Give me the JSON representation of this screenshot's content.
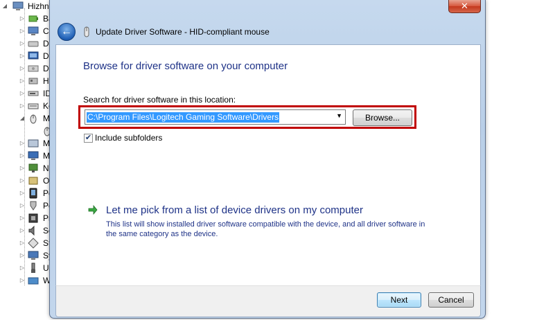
{
  "background_tree": {
    "root_label": "Hizhn",
    "items": [
      {
        "label": "Ba",
        "icon": "battery-icon"
      },
      {
        "label": "Co",
        "icon": "computer-icon"
      },
      {
        "label": "Di",
        "icon": "disk-drive-icon"
      },
      {
        "label": "Di",
        "icon": "display-adapter-icon"
      },
      {
        "label": "DV",
        "icon": "dvd-drive-icon"
      },
      {
        "label": "Hu",
        "icon": "hid-icon"
      },
      {
        "label": "ID",
        "icon": "ide-controller-icon"
      },
      {
        "label": "Ke",
        "icon": "keyboard-icon"
      },
      {
        "label": "Mi",
        "icon": "mouse-icon"
      },
      {
        "label": "",
        "icon": "mouse-icon"
      },
      {
        "label": "Mo",
        "icon": "modem-icon"
      },
      {
        "label": "Mo",
        "icon": "monitor-icon"
      },
      {
        "label": "Ne",
        "icon": "network-adapter-icon"
      },
      {
        "label": "Ot",
        "icon": "other-device-icon"
      },
      {
        "label": "Po",
        "icon": "portable-device-icon"
      },
      {
        "label": "Po",
        "icon": "port-icon"
      },
      {
        "label": "Pr",
        "icon": "processor-icon"
      },
      {
        "label": "So",
        "icon": "sound-icon"
      },
      {
        "label": "St",
        "icon": "storage-controller-icon"
      },
      {
        "label": "Sy",
        "icon": "system-device-icon"
      },
      {
        "label": "Ur",
        "icon": "usb-controller-icon"
      },
      {
        "label": "Wi",
        "icon": "wireless-icon"
      }
    ]
  },
  "dialog": {
    "title": "Update Driver Software - HID-compliant mouse",
    "close_glyph": "✕",
    "back_glyph": "←",
    "heading": "Browse for driver software on your computer",
    "search_label": "Search for driver software in this location:",
    "path_value": "C:\\Program Files\\Logitech Gaming Software\\Drivers",
    "browse_label": "Browse...",
    "include_subfolders_label": "Include subfolders",
    "include_subfolders_checked": true,
    "pick_title": "Let me pick from a list of device drivers on my computer",
    "pick_description": "This list will show installed driver software compatible with the device, and all driver software in the same category as the device.",
    "next_label": "Next",
    "cancel_label": "Cancel"
  },
  "colors": {
    "link_blue": "#1e3287",
    "highlight_red": "#c00000",
    "selection_blue": "#3399ff",
    "close_red": "#c4381d"
  }
}
